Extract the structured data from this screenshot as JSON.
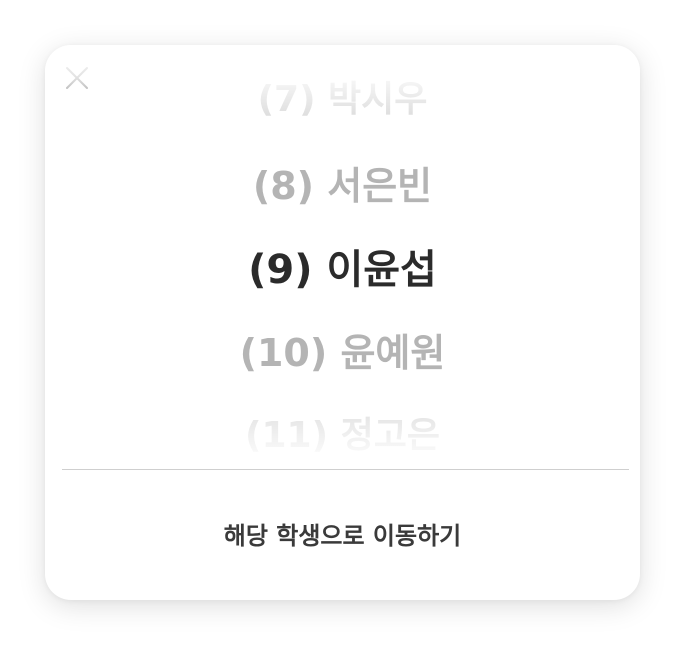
{
  "dialog": {
    "close_icon": "close-icon",
    "picker": {
      "items": [
        "(7) 박시우",
        "(8) 서은빈",
        "(9) 이윤섭",
        "(10) 윤예원",
        "(11) 정고은"
      ],
      "selected_index": 2
    },
    "action_label": "해당 학생으로 이동하기"
  },
  "colors": {
    "selected_text": "#2b2b2b",
    "unselected_text": "#b4b4b4",
    "divider": "#cfcfcf"
  }
}
